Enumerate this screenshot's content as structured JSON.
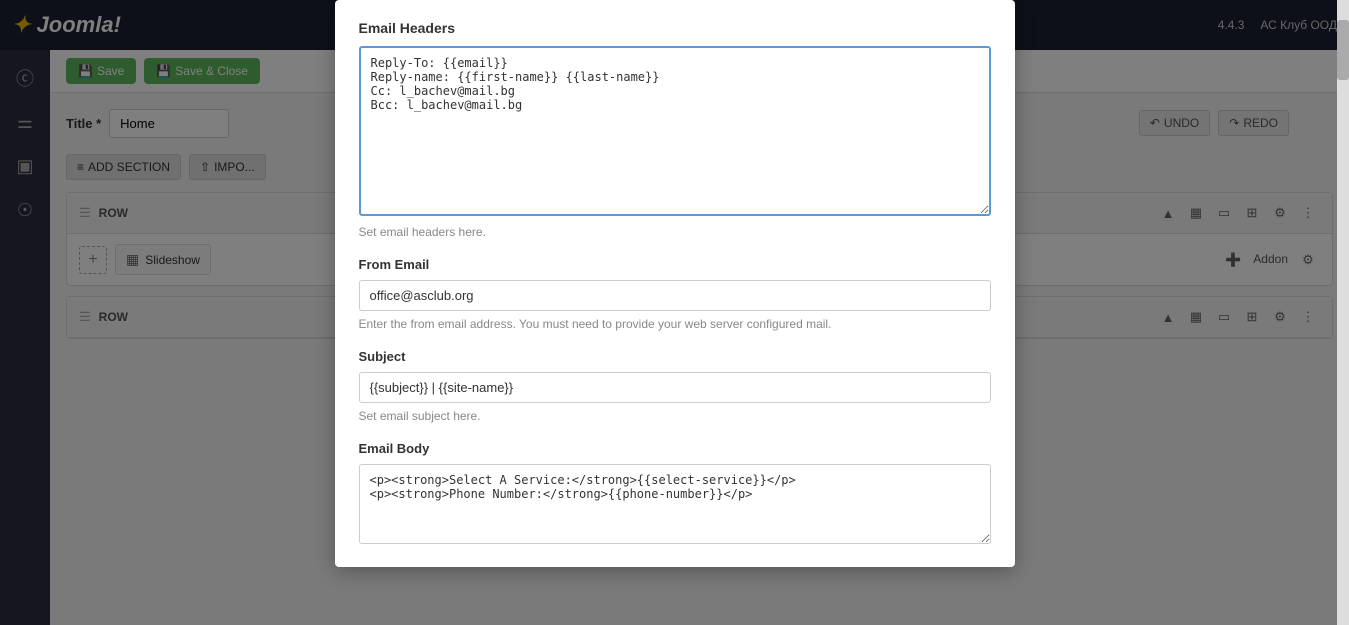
{
  "topbar": {
    "logo_text": "Joomla!",
    "version": "4.4.3",
    "user": "АС Клуб ООД"
  },
  "sidebar": {
    "icons": [
      "facebook",
      "layers",
      "calendar",
      "globe"
    ]
  },
  "toolbar": {
    "save_label": "Save",
    "save_close_label": "Save & Close"
  },
  "page": {
    "title_label": "Title *",
    "title_value": "Home"
  },
  "builder": {
    "add_section_label": "ADD SECTION",
    "import_label": "IMPO...",
    "undo_label": "UNDO",
    "redo_label": "REDO",
    "row_label": "ROW",
    "addon_label": "Addon",
    "slideshow_label": "Slideshow"
  },
  "modal": {
    "email_headers_title": "Email Headers",
    "email_headers_value": "Reply-To: {{email}}\nReply-name: {{first-name}} {{last-name}}\nCc: l_bachev@mail.bg\nBcc: l_bachev@mail.bg",
    "email_headers_hint": "Set email headers here.",
    "from_email_label": "From Email",
    "from_email_value": "office@asclub.org",
    "from_email_hint": "Enter the from email address. You must need to provide your web server configured mail.",
    "subject_label": "Subject",
    "subject_value": "{{subject}} | {{site-name}}",
    "subject_hint": "Set email subject here.",
    "email_body_label": "Email Body",
    "email_body_value": "<p><strong>Select A Service:</strong>{{select-service}}</p>\n<p><strong>Phone Number:</strong>{{phone-number}}</p>"
  }
}
